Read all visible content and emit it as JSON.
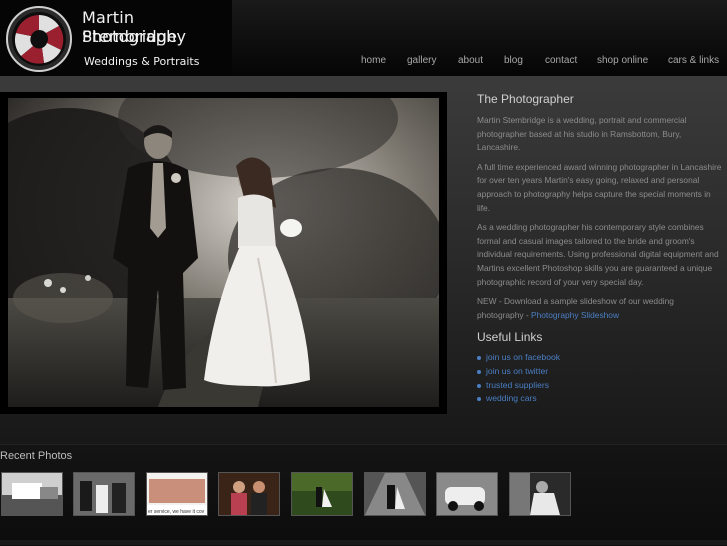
{
  "brand": {
    "name_line1": "Martin Stembridge",
    "name_line2": "Photography",
    "tagline": "Weddings & Portraits"
  },
  "nav": [
    "home",
    "gallery",
    "about",
    "blog",
    "contact",
    "shop online",
    "cars & links"
  ],
  "sidebar": {
    "title": "The Photographer",
    "paragraphs": [
      "Martin Stembridge is a wedding, portrait and commercial photographer based at his studio in Ramsbottom, Bury, Lancashire.",
      "A full time experienced award winning photographer in Lancashire for over ten years Martin's easy going, relaxed and personal approach to photography helps capture the special moments in life.",
      "As a wedding photographer his contemporary style combines formal and casual images tailored to the bride and groom's individual requirements. Using professional digital equipment and Martins excellent Photoshop skills you are guaranteed a unique photographic record of your very special day."
    ],
    "news_text": "NEW - Download a sample slideshow of our wedding photography - ",
    "news_link": "Photography Slideshow",
    "useful_title": "Useful Links",
    "useful_links": [
      "join us on facebook",
      "join us on twitter",
      "trusted suppliers",
      "wedding cars"
    ]
  },
  "recent": {
    "title": "Recent Photos",
    "thumb_caption": "er service, we have it cov"
  }
}
